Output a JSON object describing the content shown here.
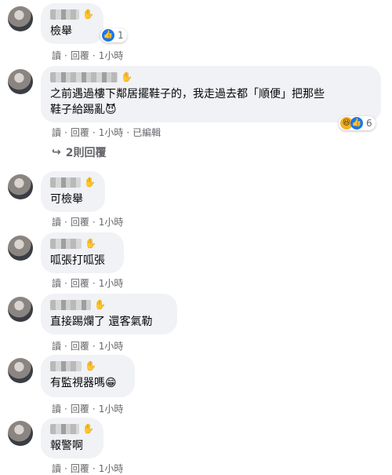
{
  "actions": {
    "read": "讀",
    "reply": "回覆",
    "sep": "·"
  },
  "comments": [
    {
      "text": "檢舉",
      "time": "1小時",
      "reaction": {
        "count": "1",
        "icon": "like-icon"
      }
    },
    {
      "line1": "之前遇過樓下鄰居擺鞋子的，我走過去都「順便」把那些",
      "line2": "鞋子給踢亂",
      "line2_emoji": "😈",
      "time": "1小時",
      "edited": "已編輯",
      "reaction": {
        "count": "6",
        "icons": [
          "haha-icon",
          "like-icon"
        ]
      }
    },
    {
      "text": "可檢舉",
      "time": "1小時"
    },
    {
      "text": "呱張打呱張",
      "time": "1小時"
    },
    {
      "text": "直接踢爛了 還客氣勒",
      "time": "1小時"
    },
    {
      "text": "有監視器嗎",
      "emoji": "😁",
      "time": "1小時"
    },
    {
      "text": "報警啊",
      "time": "1小時"
    }
  ],
  "replies_label": "2則回覆",
  "colors": {
    "bubble": "#f0f2f5",
    "meta": "#65676b",
    "like": "#1877f2"
  }
}
